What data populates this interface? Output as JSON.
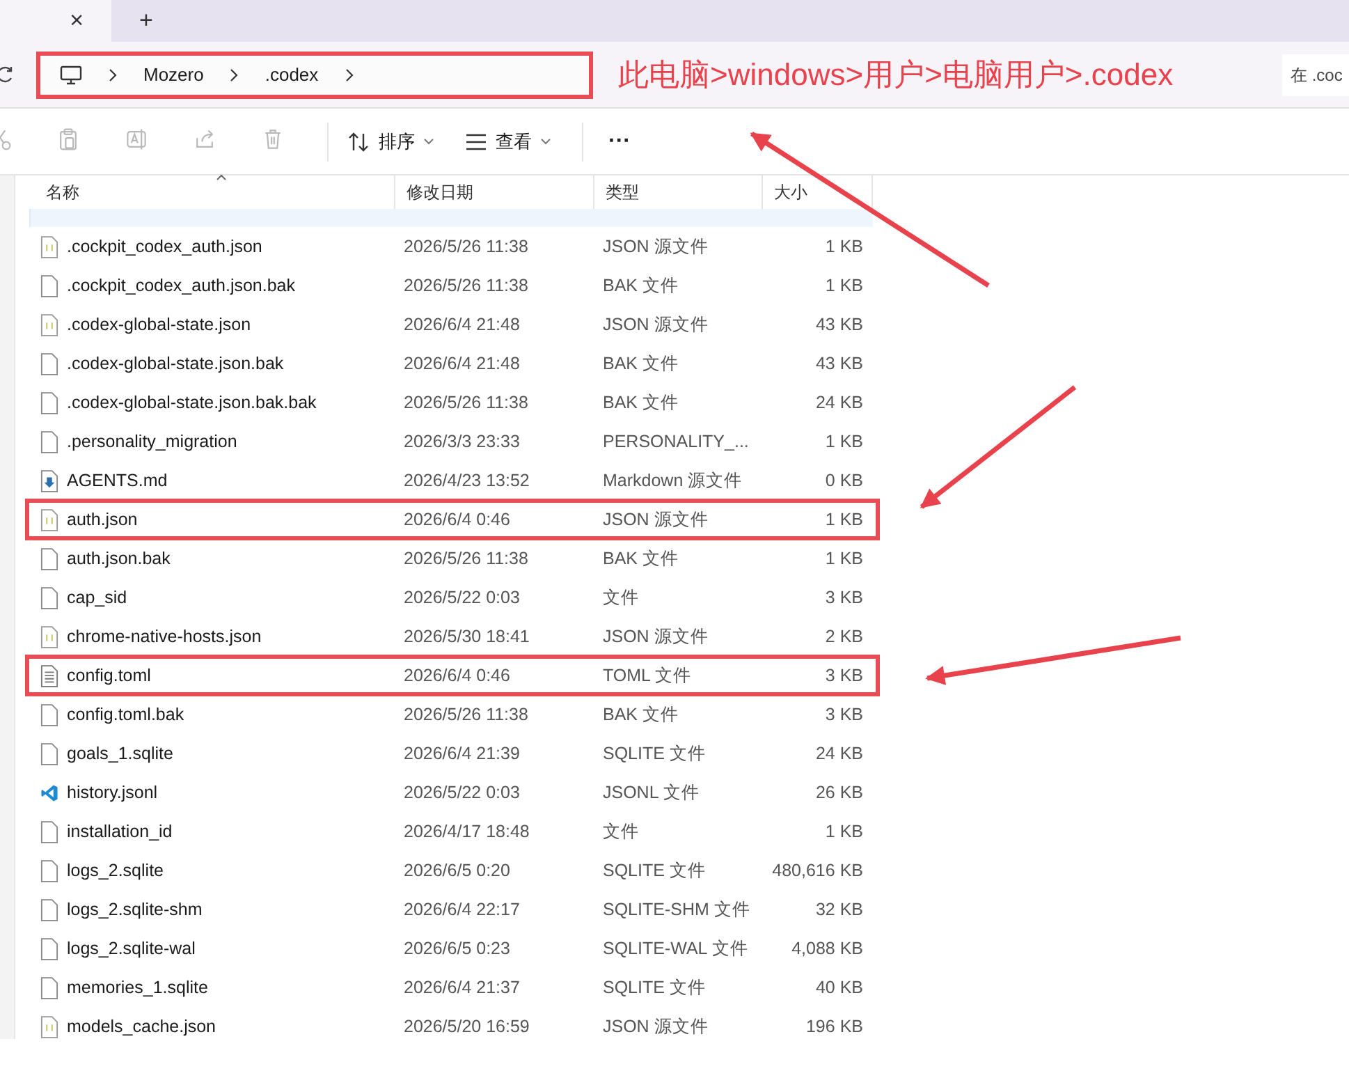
{
  "tabs": [
    {
      "kind": "close",
      "label": "×"
    },
    {
      "kind": "new",
      "label": "+"
    }
  ],
  "address": {
    "breadcrumbs": [
      "Mozero",
      ".codex"
    ],
    "annotation": "此电脑>windows>用户>电脑用户>.codex",
    "search_placeholder": "在 .coc"
  },
  "toolbar": {
    "buttons": [
      {
        "kind": "cut",
        "disabled": true
      },
      {
        "kind": "paste",
        "disabled": true
      },
      {
        "kind": "rename",
        "disabled": true
      },
      {
        "kind": "share",
        "disabled": true
      },
      {
        "kind": "delete",
        "disabled": true
      }
    ],
    "sort": "排序",
    "view": "查看",
    "more": "···"
  },
  "table": {
    "columns": [
      "名称",
      "修改日期",
      "类型",
      "大小"
    ],
    "rows": [
      {
        "kind": "json",
        "name": ".cockpit_codex_auth.json",
        "date": "2026/5/26 11:38",
        "type": "JSON 源文件",
        "size": "1 KB",
        "highlighted": false
      },
      {
        "kind": "file",
        "name": ".cockpit_codex_auth.json.bak",
        "date": "2026/5/26 11:38",
        "type": "BAK 文件",
        "size": "1 KB",
        "highlighted": false
      },
      {
        "kind": "json",
        "name": ".codex-global-state.json",
        "date": "2026/6/4 21:48",
        "type": "JSON 源文件",
        "size": "43 KB",
        "highlighted": false
      },
      {
        "kind": "file",
        "name": ".codex-global-state.json.bak",
        "date": "2026/6/4 21:48",
        "type": "BAK 文件",
        "size": "43 KB",
        "highlighted": false
      },
      {
        "kind": "file",
        "name": ".codex-global-state.json.bak.bak",
        "date": "2026/5/26 11:38",
        "type": "BAK 文件",
        "size": "24 KB",
        "highlighted": false
      },
      {
        "kind": "file",
        "name": ".personality_migration",
        "date": "2026/3/3 23:33",
        "type": "PERSONALITY_...",
        "size": "1 KB",
        "highlighted": false
      },
      {
        "kind": "markdown",
        "name": "AGENTS.md",
        "date": "2026/4/23 13:52",
        "type": "Markdown 源文件",
        "size": "0 KB",
        "highlighted": false
      },
      {
        "kind": "json",
        "name": "auth.json",
        "date": "2026/6/4 0:46",
        "type": "JSON 源文件",
        "size": "1 KB",
        "highlighted": true
      },
      {
        "kind": "file",
        "name": "auth.json.bak",
        "date": "2026/5/26 11:38",
        "type": "BAK 文件",
        "size": "1 KB",
        "highlighted": false
      },
      {
        "kind": "file",
        "name": "cap_sid",
        "date": "2026/5/22 0:03",
        "type": "文件",
        "size": "3 KB",
        "highlighted": false
      },
      {
        "kind": "json",
        "name": "chrome-native-hosts.json",
        "date": "2026/5/30 18:41",
        "type": "JSON 源文件",
        "size": "2 KB",
        "highlighted": false
      },
      {
        "kind": "text",
        "name": "config.toml",
        "date": "2026/6/4 0:46",
        "type": "TOML 文件",
        "size": "3 KB",
        "highlighted": true
      },
      {
        "kind": "file",
        "name": "config.toml.bak",
        "date": "2026/5/26 11:38",
        "type": "BAK 文件",
        "size": "3 KB",
        "highlighted": false
      },
      {
        "kind": "file",
        "name": "goals_1.sqlite",
        "date": "2026/6/4 21:39",
        "type": "SQLITE 文件",
        "size": "24 KB",
        "highlighted": false
      },
      {
        "kind": "vscode",
        "name": "history.jsonl",
        "date": "2026/5/22 0:03",
        "type": "JSONL 文件",
        "size": "26 KB",
        "highlighted": false
      },
      {
        "kind": "file",
        "name": "installation_id",
        "date": "2026/4/17 18:48",
        "type": "文件",
        "size": "1 KB",
        "highlighted": false
      },
      {
        "kind": "file",
        "name": "logs_2.sqlite",
        "date": "2026/6/5 0:20",
        "type": "SQLITE 文件",
        "size": "480,616 KB",
        "highlighted": false
      },
      {
        "kind": "file",
        "name": "logs_2.sqlite-shm",
        "date": "2026/6/4 22:17",
        "type": "SQLITE-SHM 文件",
        "size": "32 KB",
        "highlighted": false
      },
      {
        "kind": "file",
        "name": "logs_2.sqlite-wal",
        "date": "2026/6/5 0:23",
        "type": "SQLITE-WAL 文件",
        "size": "4,088 KB",
        "highlighted": false
      },
      {
        "kind": "file",
        "name": "memories_1.sqlite",
        "date": "2026/6/4 21:37",
        "type": "SQLITE 文件",
        "size": "40 KB",
        "highlighted": false
      },
      {
        "kind": "json",
        "name": "models_cache.json",
        "date": "2026/5/20 16:59",
        "type": "JSON 源文件",
        "size": "196 KB",
        "highlighted": false
      }
    ]
  }
}
